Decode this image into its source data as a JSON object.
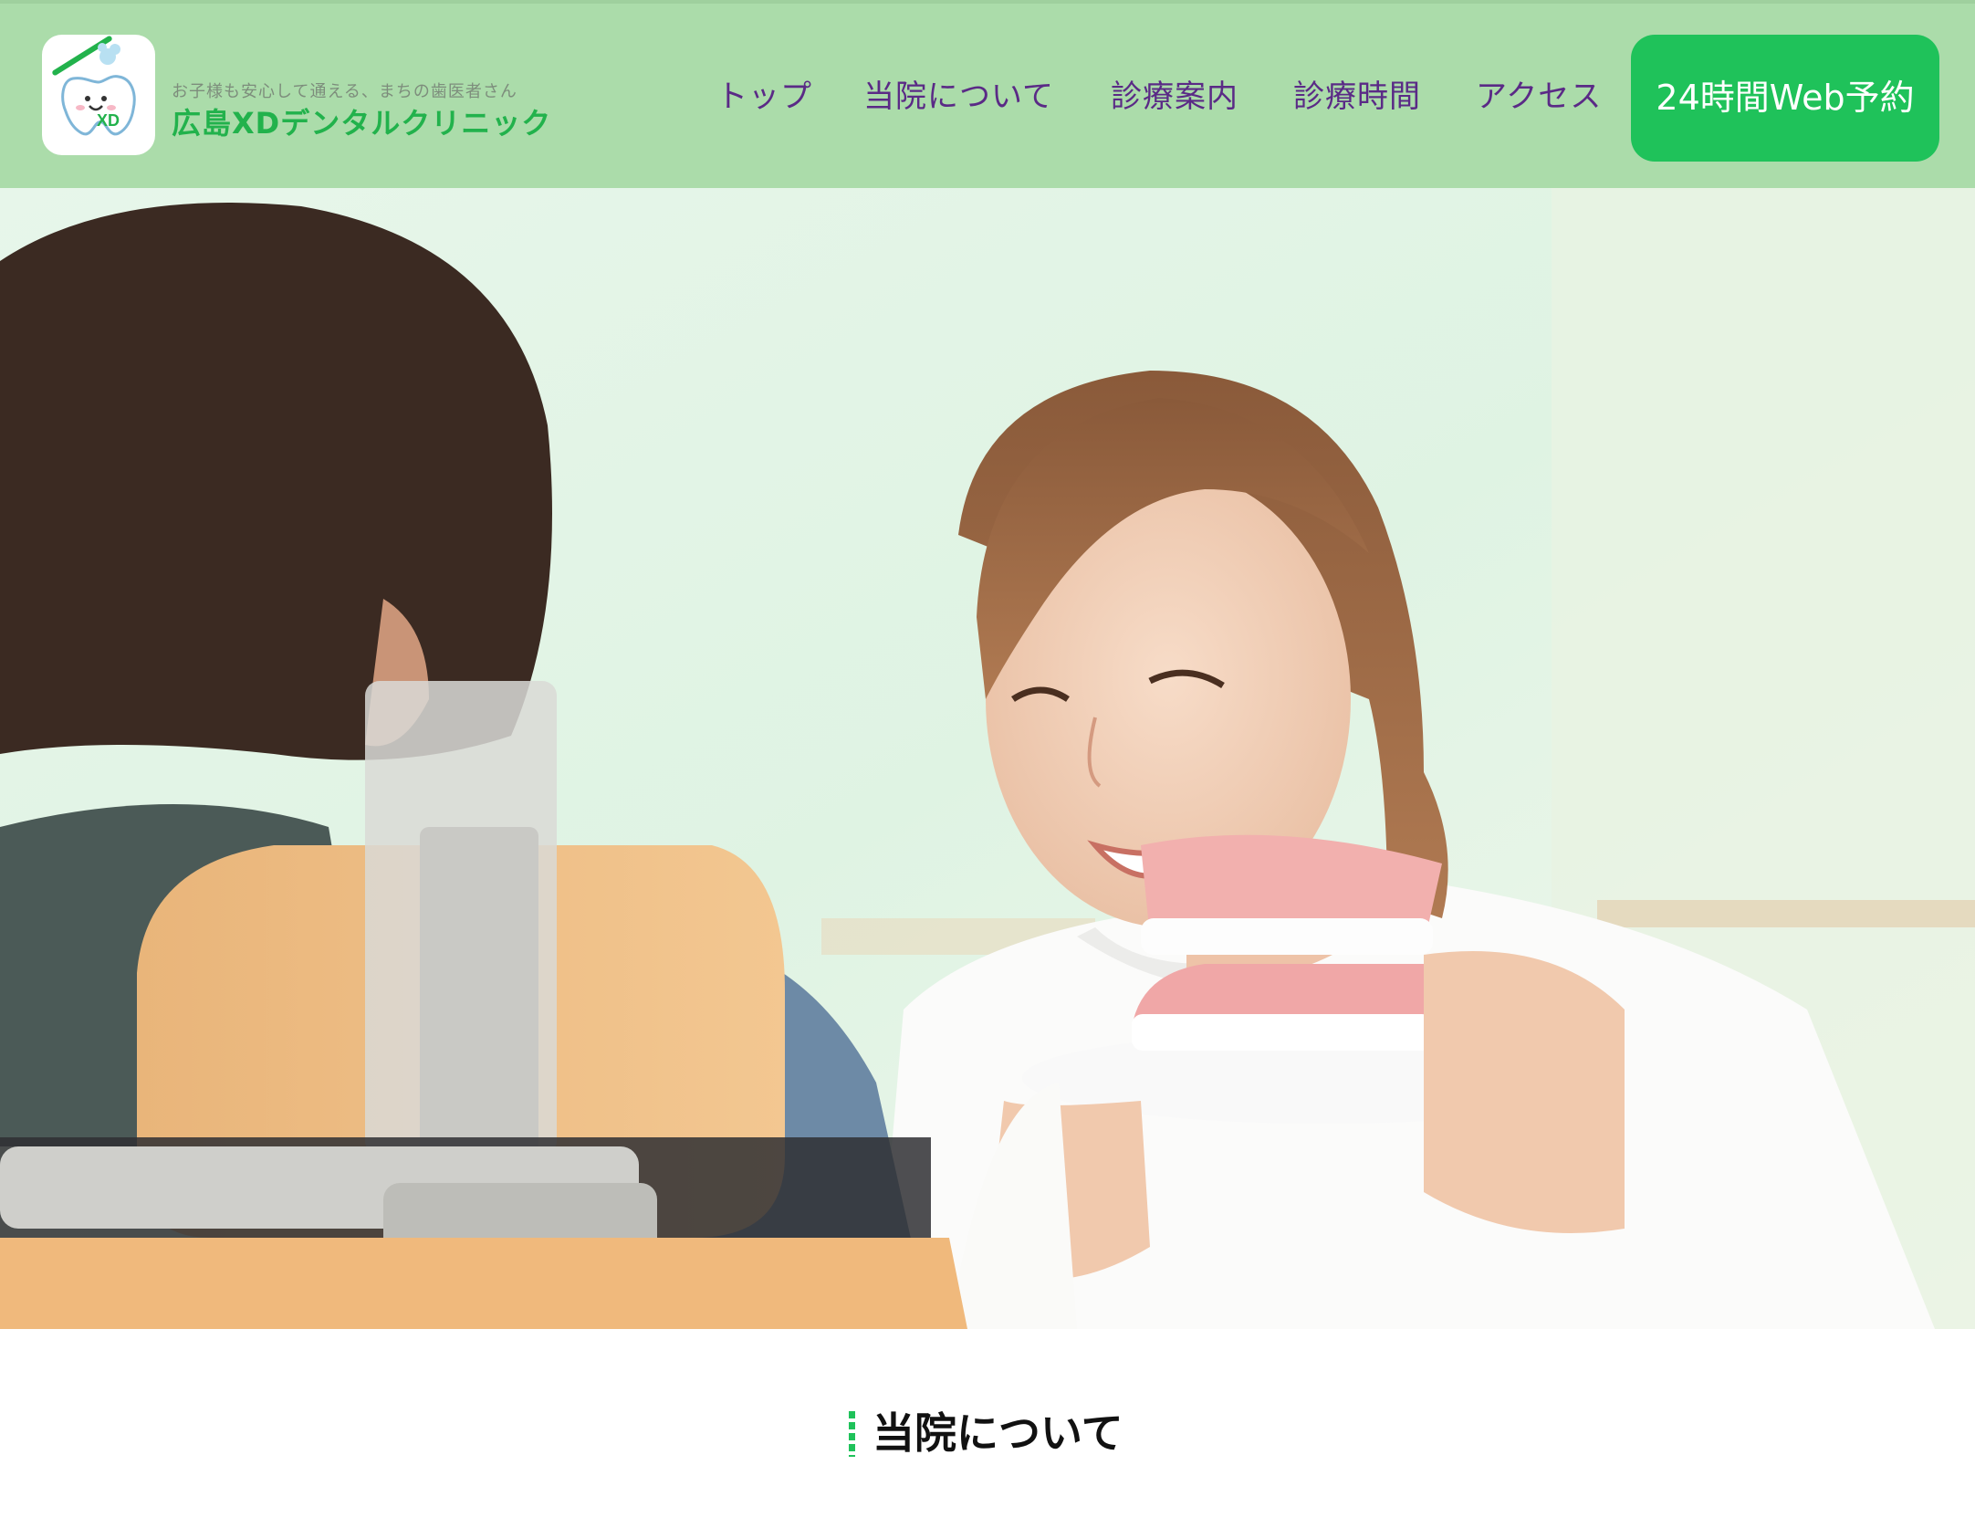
{
  "header": {
    "logo_icon": "tooth-mascot-with-toothbrush",
    "logo_badge": "XD",
    "tagline": "お子様も安心して通える、まちの歯医者さん",
    "clinic_name": "広島XDデンタルクリニック",
    "background_color": "#abdcaa"
  },
  "nav": {
    "items": [
      {
        "label": "トップ"
      },
      {
        "label": "当院について"
      },
      {
        "label": "診療案内"
      },
      {
        "label": "診療時間"
      },
      {
        "label": "アクセス"
      }
    ],
    "text_color": "#5a2a86"
  },
  "cta": {
    "label": "24時間Web予約",
    "color": "#1fc25a"
  },
  "hero": {
    "image": "dental-hygienist-explaining-denture-model-to-patient"
  },
  "section": {
    "title": "当院について",
    "accent_color": "#1fc25a"
  }
}
